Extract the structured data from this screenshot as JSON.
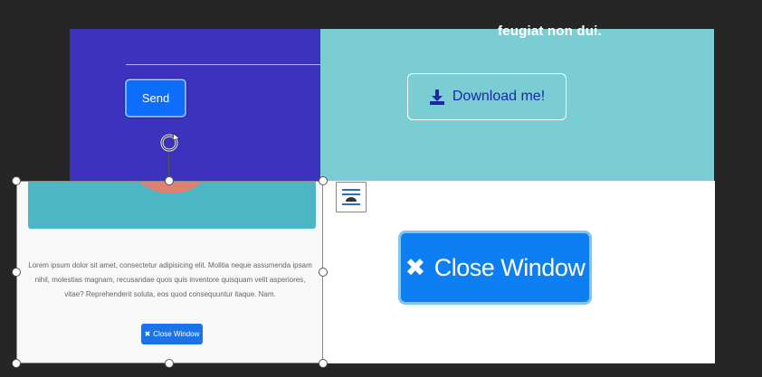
{
  "slide": {
    "teal_text": "feugiat non dui.",
    "send_label": "Send",
    "download_label": "Download me!",
    "big_close_label": "Close Window"
  },
  "selected_image": {
    "paragraph": "Lorem ipsum dolor sit amet, consectetur adipisicing elit. Molitia neque assumenda ipsam nihil, molestias magnam, recusandae quos quis inventore quisquam velit asperiores, vitae? Reprehenderit soluta, eos quod consequuntur itaque. Nam.",
    "close_label": "Close Window"
  },
  "icons": {
    "download": "download-icon",
    "close": "x-icon",
    "rotate": "rotate-icon",
    "layout_options": "layout-options-icon"
  },
  "colors": {
    "purple_panel": "#3d32be",
    "teal_panel": "#79cdd3",
    "button_blue": "#0d6efd",
    "download_text": "#1a2aa8"
  }
}
